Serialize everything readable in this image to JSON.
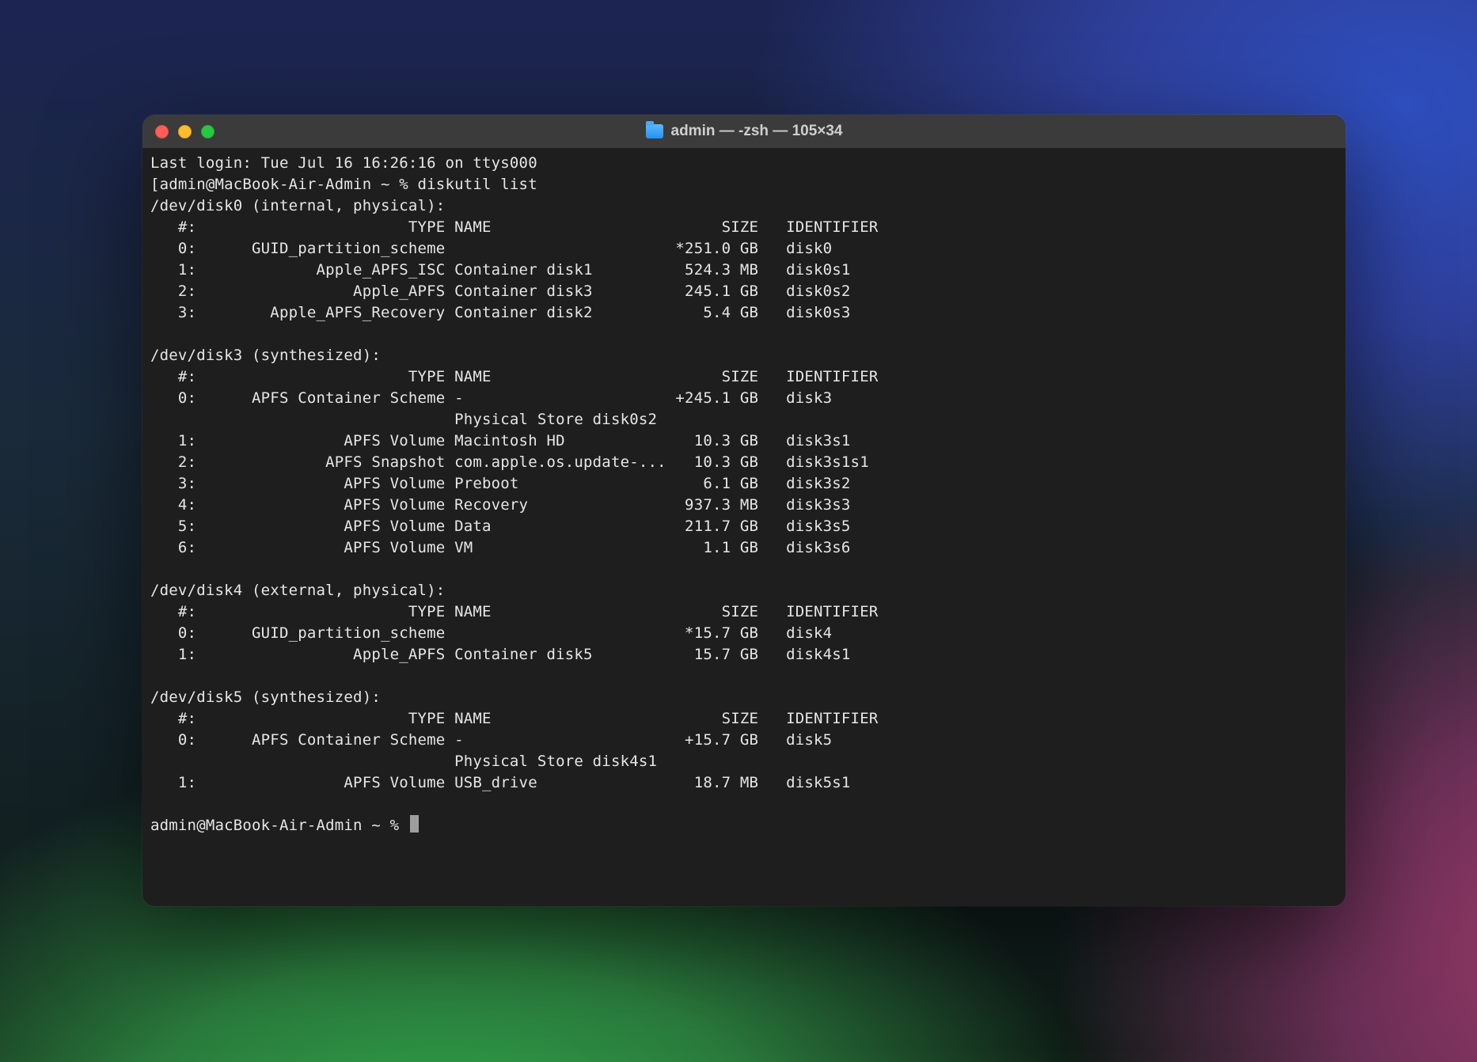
{
  "window": {
    "title": "admin — -zsh — 105×34"
  },
  "terminal": {
    "last_login": "Last login: Tue Jul 16 16:26:16 on ttys000",
    "prompt1_open": "[admin@MacBook-Air-Admin ~ % ",
    "command": "diskutil list",
    "prompt1_close": "]",
    "prompt2": "admin@MacBook-Air-Admin ~ % ",
    "disks": [
      {
        "device": "/dev/disk0",
        "desc": "(internal, physical):",
        "header": {
          "num": "#",
          "type": "TYPE",
          "name": "NAME",
          "size": "SIZE",
          "id": "IDENTIFIER"
        },
        "rows": [
          {
            "num": "0",
            "type": "GUID_partition_scheme",
            "name": "",
            "size": "*251.0 GB",
            "id": "disk0"
          },
          {
            "num": "1",
            "type": "Apple_APFS_ISC",
            "name": "Container disk1",
            "size": "524.3 MB",
            "id": "disk0s1"
          },
          {
            "num": "2",
            "type": "Apple_APFS",
            "name": "Container disk3",
            "size": "245.1 GB",
            "id": "disk0s2"
          },
          {
            "num": "3",
            "type": "Apple_APFS_Recovery",
            "name": "Container disk2",
            "size": "5.4 GB",
            "id": "disk0s3"
          }
        ]
      },
      {
        "device": "/dev/disk3",
        "desc": "(synthesized):",
        "header": {
          "num": "#",
          "type": "TYPE",
          "name": "NAME",
          "size": "SIZE",
          "id": "IDENTIFIER"
        },
        "rows": [
          {
            "num": "0",
            "type": "APFS Container Scheme",
            "name": "-",
            "size": "+245.1 GB",
            "id": "disk3"
          },
          {
            "extra": "Physical Store disk0s2"
          },
          {
            "num": "1",
            "type": "APFS Volume",
            "name": "Macintosh HD",
            "size": "10.3 GB",
            "id": "disk3s1"
          },
          {
            "num": "2",
            "type": "APFS Snapshot",
            "name": "com.apple.os.update-...",
            "size": "10.3 GB",
            "id": "disk3s1s1"
          },
          {
            "num": "3",
            "type": "APFS Volume",
            "name": "Preboot",
            "size": "6.1 GB",
            "id": "disk3s2"
          },
          {
            "num": "4",
            "type": "APFS Volume",
            "name": "Recovery",
            "size": "937.3 MB",
            "id": "disk3s3"
          },
          {
            "num": "5",
            "type": "APFS Volume",
            "name": "Data",
            "size": "211.7 GB",
            "id": "disk3s5"
          },
          {
            "num": "6",
            "type": "APFS Volume",
            "name": "VM",
            "size": "1.1 GB",
            "id": "disk3s6"
          }
        ]
      },
      {
        "device": "/dev/disk4",
        "desc": "(external, physical):",
        "header": {
          "num": "#",
          "type": "TYPE",
          "name": "NAME",
          "size": "SIZE",
          "id": "IDENTIFIER"
        },
        "rows": [
          {
            "num": "0",
            "type": "GUID_partition_scheme",
            "name": "",
            "size": "*15.7 GB",
            "id": "disk4"
          },
          {
            "num": "1",
            "type": "Apple_APFS",
            "name": "Container disk5",
            "size": "15.7 GB",
            "id": "disk4s1"
          }
        ]
      },
      {
        "device": "/dev/disk5",
        "desc": "(synthesized):",
        "header": {
          "num": "#",
          "type": "TYPE",
          "name": "NAME",
          "size": "SIZE",
          "id": "IDENTIFIER"
        },
        "rows": [
          {
            "num": "0",
            "type": "APFS Container Scheme",
            "name": "-",
            "size": "+15.7 GB",
            "id": "disk5"
          },
          {
            "extra": "Physical Store disk4s1"
          },
          {
            "num": "1",
            "type": "APFS Volume",
            "name": "USB_drive",
            "size": "18.7 MB",
            "id": "disk5s1"
          }
        ]
      }
    ]
  }
}
